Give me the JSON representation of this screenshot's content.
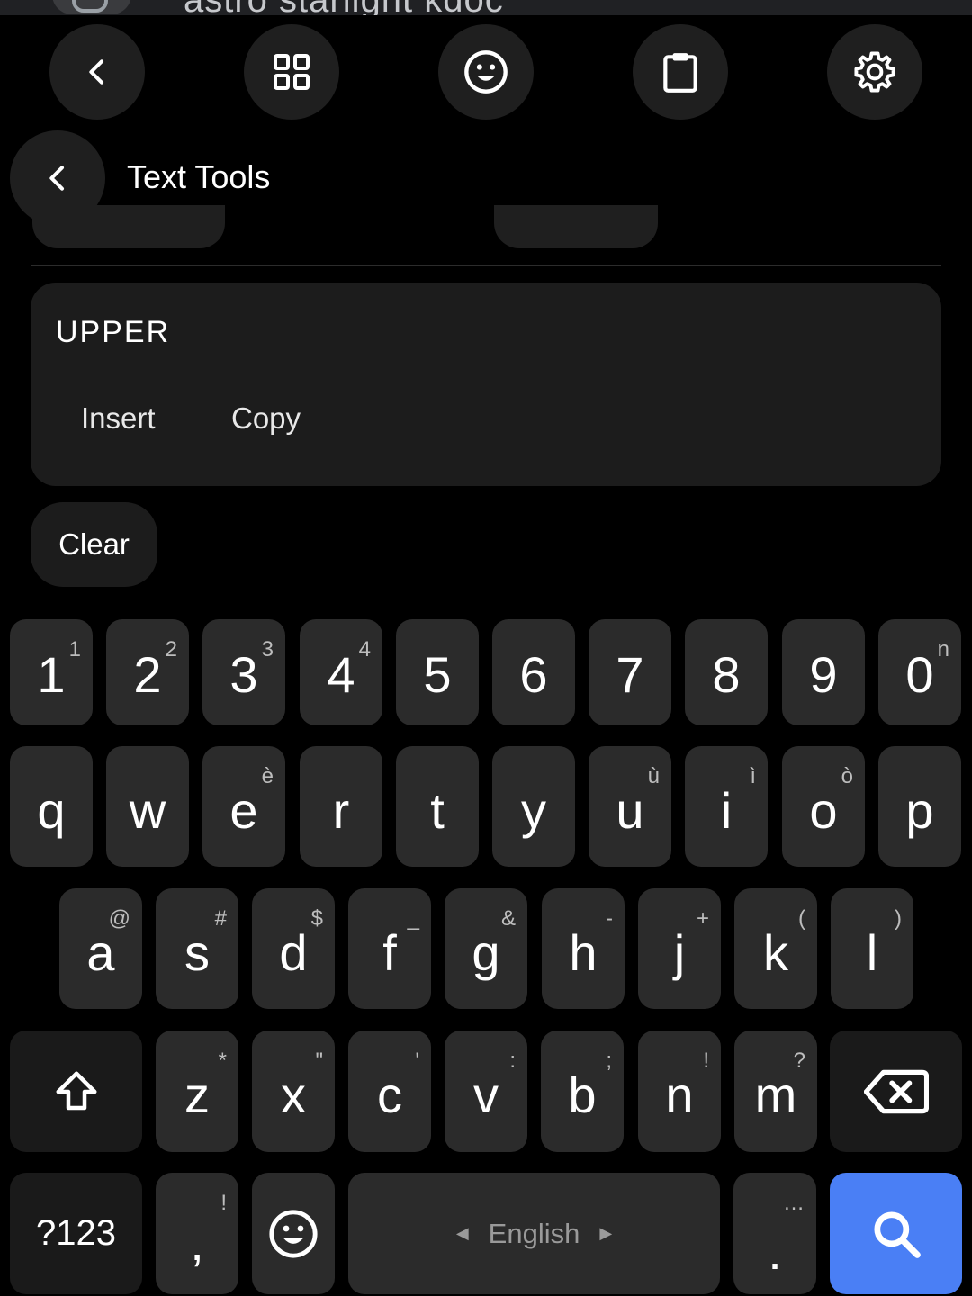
{
  "peek_bar": {
    "text": "astro starlight kdoc"
  },
  "toolbar": {
    "back_icon": "chevron-left-icon",
    "apps_icon": "grid-icon",
    "emoji_icon": "smiley-icon",
    "clipboard_icon": "clipboard-icon",
    "settings_icon": "gear-icon"
  },
  "header": {
    "title": "Text Tools"
  },
  "result_card": {
    "text": "UPPER",
    "insert_label": "Insert",
    "copy_label": "Copy"
  },
  "clear_label": "Clear",
  "keyboard": {
    "number_row": [
      {
        "main": "1",
        "hint": "1"
      },
      {
        "main": "2",
        "hint": "2"
      },
      {
        "main": "3",
        "hint": "3"
      },
      {
        "main": "4",
        "hint": "4"
      },
      {
        "main": "5",
        "hint": ""
      },
      {
        "main": "6",
        "hint": ""
      },
      {
        "main": "7",
        "hint": ""
      },
      {
        "main": "8",
        "hint": ""
      },
      {
        "main": "9",
        "hint": ""
      },
      {
        "main": "0",
        "hint": "n"
      }
    ],
    "row1": [
      {
        "main": "q",
        "hint": ""
      },
      {
        "main": "w",
        "hint": ""
      },
      {
        "main": "e",
        "hint": "è"
      },
      {
        "main": "r",
        "hint": ""
      },
      {
        "main": "t",
        "hint": ""
      },
      {
        "main": "y",
        "hint": ""
      },
      {
        "main": "u",
        "hint": "ù"
      },
      {
        "main": "i",
        "hint": "ì"
      },
      {
        "main": "o",
        "hint": "ò"
      },
      {
        "main": "p",
        "hint": ""
      }
    ],
    "row2": [
      {
        "main": "a",
        "hint": "@"
      },
      {
        "main": "s",
        "hint": "#"
      },
      {
        "main": "d",
        "hint": "$"
      },
      {
        "main": "f",
        "hint": "_"
      },
      {
        "main": "g",
        "hint": "&"
      },
      {
        "main": "h",
        "hint": "-"
      },
      {
        "main": "j",
        "hint": "+"
      },
      {
        "main": "k",
        "hint": "("
      },
      {
        "main": "l",
        "hint": ")"
      }
    ],
    "row3": [
      {
        "main": "z",
        "hint": "*"
      },
      {
        "main": "x",
        "hint": "\""
      },
      {
        "main": "c",
        "hint": "'"
      },
      {
        "main": "v",
        "hint": ":"
      },
      {
        "main": "b",
        "hint": ";"
      },
      {
        "main": "n",
        "hint": "!"
      },
      {
        "main": "m",
        "hint": "?"
      }
    ],
    "shift_icon": "shift-arrow-icon",
    "backspace_icon": "backspace-icon",
    "symbols_label": "?123",
    "comma": {
      "main": ",",
      "hint": "!"
    },
    "emoji_icon": "smiley-icon",
    "space_label": "English",
    "period": {
      "main": ".",
      "hint": "…"
    },
    "action_icon": "search-icon",
    "accent_color": "#4a7ff5"
  }
}
